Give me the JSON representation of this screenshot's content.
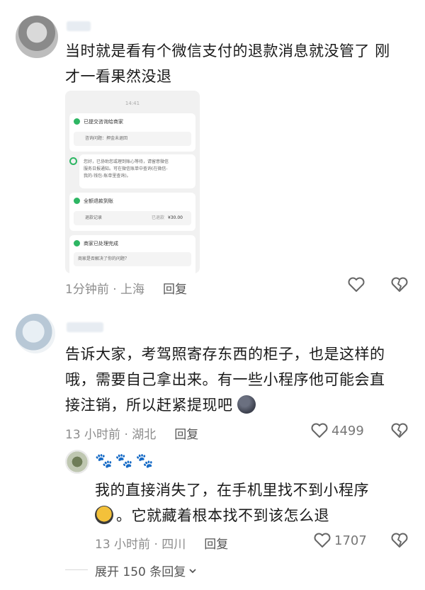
{
  "comments": [
    {
      "text": "当时就是看有个微信支付的退款消息就没管了 刚才一看果然没退",
      "line1": "当时就是看有个微信支付的退款消息就没管了 刚",
      "line2": "才一看果然没退",
      "time_location": "1分钟前 · 上海",
      "reply_label": "回复",
      "screenshot": {
        "time": "14:41",
        "step1_title": "已提交咨询给商家",
        "step1_row": "咨询问题：押金未退回",
        "msg": "您好，已协助您或理到账心等待，请留意微信服务日报通知。可在微信账单中查询(在微信-我的-钱包-账单里查询)。",
        "msg_l1": "您好，已协助您或理到账心等待，请留意微信",
        "msg_l2": "服务日报通知。可在微信账单中查询(在微信-",
        "msg_l3": "我的-钱包-账单里查询)。",
        "step2_title": "全额退款到账",
        "step2_row_label": "退款记录",
        "step2_row_status": "已退款",
        "step2_row_amount": "¥30.00",
        "step3_title": "商家已处理完成",
        "step3_row": "商家是否解决了你的问题？"
      }
    },
    {
      "line1": "告诉大家，考驾照寄存东西的柜子，也是这样的",
      "line2": "哦，需要自己拿出来。有一些小程序他可能会直",
      "line3": "接注销，所以赶紧提现吧",
      "time_location": "13 小时前 · 湖北",
      "reply_label": "回复",
      "likes": "4499"
    }
  ],
  "reply": {
    "username": "🐾🐾🐾",
    "line1": "我的直接消失了，在手机里找不到小程序",
    "line2": "。它就藏着根本找不到该怎么退",
    "time_location": "13 小时前 · 四川",
    "reply_label": "回复",
    "likes": "1707"
  },
  "expand_label": "展开 150 条回复",
  "icons": [
    "heart-icon",
    "broken-heart-icon",
    "chevron-down-icon",
    "check-icon"
  ],
  "colors": {
    "accent_green": "#2db663",
    "meta_gray": "#8c8c8c"
  }
}
